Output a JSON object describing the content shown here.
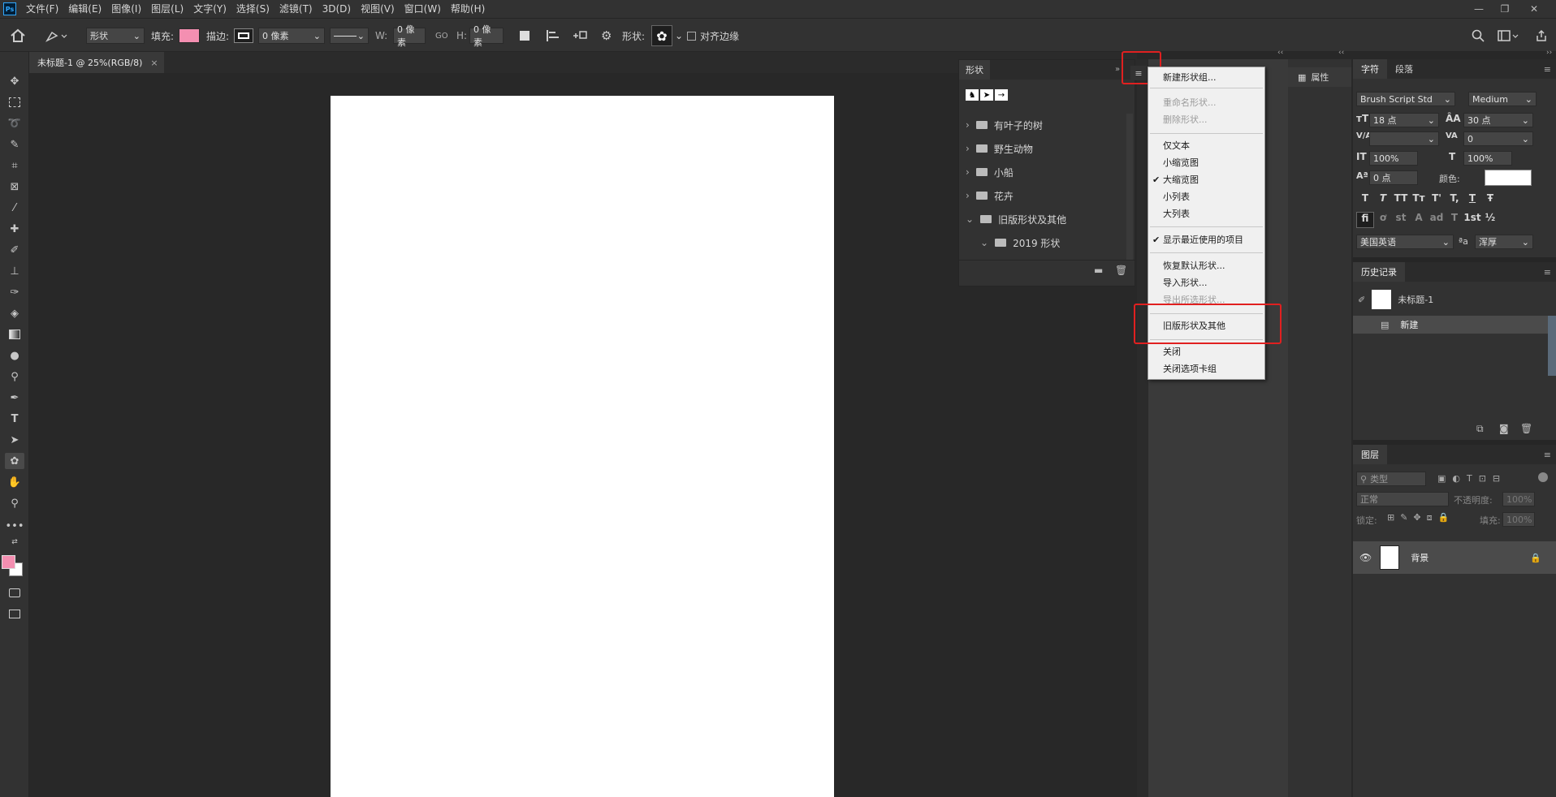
{
  "app": {
    "logo": "Ps"
  },
  "menubar": {
    "items": [
      "文件(F)",
      "编辑(E)",
      "图像(I)",
      "图层(L)",
      "文字(Y)",
      "选择(S)",
      "滤镜(T)",
      "3D(D)",
      "视图(V)",
      "窗口(W)",
      "帮助(H)"
    ],
    "min": "—",
    "restore": "❐",
    "close": "✕"
  },
  "options": {
    "mode_value": "形状",
    "fill_label": "填充:",
    "fill_color": "#f48fb1",
    "stroke_label": "描边:",
    "stroke_width": "0 像素",
    "w_label": "W:",
    "w_value": "0 像素",
    "link_icon": "GO",
    "h_label": "H:",
    "h_value": "0 像素",
    "shape_label": "形状:",
    "align_edges_label": "对齐边缘"
  },
  "document": {
    "tab_title": "未标题-1 @ 25%(RGB/8)",
    "tab_close": "×"
  },
  "shapes_panel": {
    "title": "形状",
    "folders": [
      "有叶子的树",
      "野生动物",
      "小船",
      "花卉",
      "旧版形状及其他",
      "2019 形状"
    ]
  },
  "context_menu": {
    "items": [
      {
        "label": "新建形状组...",
        "disabled": false,
        "checked": false
      },
      {
        "label": "重命名形状...",
        "disabled": true,
        "checked": false
      },
      {
        "label": "删除形状...",
        "disabled": true,
        "checked": false
      },
      {
        "label": "仅文本",
        "disabled": false,
        "checked": false
      },
      {
        "label": "小缩览图",
        "disabled": false,
        "checked": false
      },
      {
        "label": "大缩览图",
        "disabled": false,
        "checked": true
      },
      {
        "label": "小列表",
        "disabled": false,
        "checked": false
      },
      {
        "label": "大列表",
        "disabled": false,
        "checked": false
      },
      {
        "label": "显示最近使用的项目",
        "disabled": false,
        "checked": true
      },
      {
        "label": "恢复默认形状...",
        "disabled": false,
        "checked": false
      },
      {
        "label": "导入形状...",
        "disabled": false,
        "checked": false
      },
      {
        "label": "导出所选形状...",
        "disabled": true,
        "checked": false
      },
      {
        "label": "旧版形状及其他",
        "disabled": false,
        "checked": false
      },
      {
        "label": "关闭",
        "disabled": false,
        "checked": false
      },
      {
        "label": "关闭选项卡组",
        "disabled": false,
        "checked": false
      }
    ],
    "checkmark": "✔"
  },
  "properties_panel": {
    "label": "属性"
  },
  "character_panel": {
    "tabs": [
      "字符",
      "段落"
    ],
    "font_family": "Brush Script Std",
    "font_style": "Medium",
    "font_size": "18 点",
    "leading": "30 点",
    "kerning": "",
    "tracking": "0",
    "vscale": "100%",
    "hscale": "100%",
    "baseline": "0 点",
    "color_label": "颜色:",
    "language": "美国英语",
    "aa_label": "ªa",
    "antialias": "浑厚",
    "style_glyphs": [
      "T",
      "T",
      "TT",
      "Tт",
      "T'",
      "T,",
      "T",
      "Ŧ"
    ],
    "ot_glyphs": [
      "fi",
      "ơ",
      "st",
      "A",
      "ad",
      "T",
      "1st",
      "½"
    ]
  },
  "history_panel": {
    "title": "历史记录",
    "snapshot": "未标题-1",
    "step": "新建"
  },
  "layers_panel": {
    "title": "图层",
    "filter_placeholder": "类型",
    "blend_mode": "正常",
    "opacity_label": "不透明度:",
    "opacity": "100%",
    "lock_label": "锁定:",
    "fill_label": "填充:",
    "fill": "100%",
    "layer_name": "背景"
  }
}
